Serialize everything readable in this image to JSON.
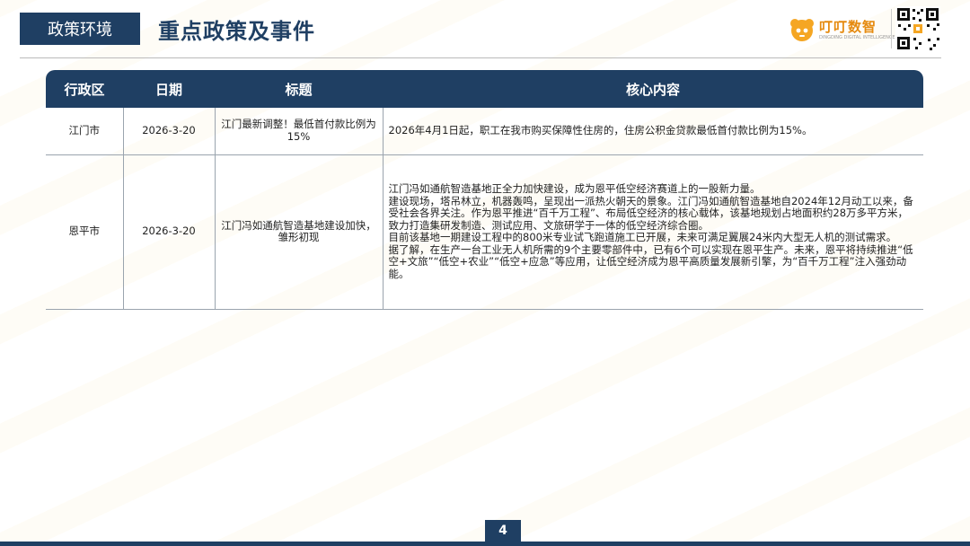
{
  "header": {
    "section_tag": "政策环境",
    "title": "重点政策及事件",
    "logo": {
      "name": "叮叮数智",
      "subtitle": "DINGDING DIGITAL INTELLIGENCE",
      "brand_color": "#e58a0f"
    },
    "qr_code": "qr-code"
  },
  "table": {
    "columns": [
      "行政区",
      "日期",
      "标题",
      "核心内容"
    ],
    "rows": [
      {
        "district": "江门市",
        "date": "2026-3-20",
        "title": "江门最新调整！最低首付款比例为15%",
        "content": [
          "2026年4月1日起，职工在我市购买保障性住房的，住房公积金贷款最低首付款比例为15%。"
        ]
      },
      {
        "district": "恩平市",
        "date": "2026-3-20",
        "title": "江门冯如通航智造基地建设加快，雏形初现",
        "content": [
          "江门冯如通航智造基地正全力加快建设，成为恩平低空经济赛道上的一股新力量。",
          "建设现场，塔吊林立，机器轰鸣，呈现出一派热火朝天的景象。江门冯如通航智造基地自2024年12月动工以来，备受社会各界关注。作为恩平推进“百千万工程”、布局低空经济的核心载体，该基地规划占地面积约28万多平方米，致力打造集研发制造、测试应用、文旅研学于一体的低空经济综合圈。",
          "目前该基地一期建设工程中的800米专业试飞跑道施工已开展，未来可满足翼展24米内大型无人机的测试需求。",
          "据了解，在生产一台工业无人机所需的9个主要零部件中，已有6个可以实现在恩平生产。未来，恩平将持续推进“低空+文旅”“低空+农业”“低空+应急”等应用，让低空经济成为恩平高质量发展新引擎，为“百千万工程”注入强劲动能。"
        ]
      }
    ]
  },
  "footer": {
    "page_number": "4"
  },
  "colors": {
    "primary": "#1f3f63",
    "accent": "#e58a0f"
  }
}
